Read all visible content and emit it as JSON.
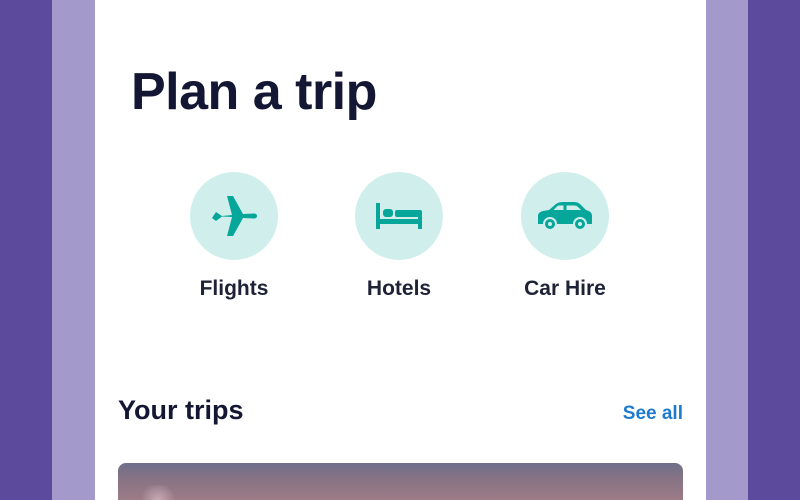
{
  "page": {
    "title": "Plan a trip"
  },
  "quick_actions": [
    {
      "label": "Flights",
      "icon": "airplane-icon"
    },
    {
      "label": "Hotels",
      "icon": "bed-icon"
    },
    {
      "label": "Car Hire",
      "icon": "car-icon"
    }
  ],
  "trips_section": {
    "title": "Your trips",
    "see_all_label": "See all"
  },
  "colors": {
    "icon_accent": "#06a79a",
    "icon_circle": "#d0efec",
    "link": "#1e7bd0",
    "title_text": "#131734",
    "outer_background": "#5c4a9c"
  }
}
